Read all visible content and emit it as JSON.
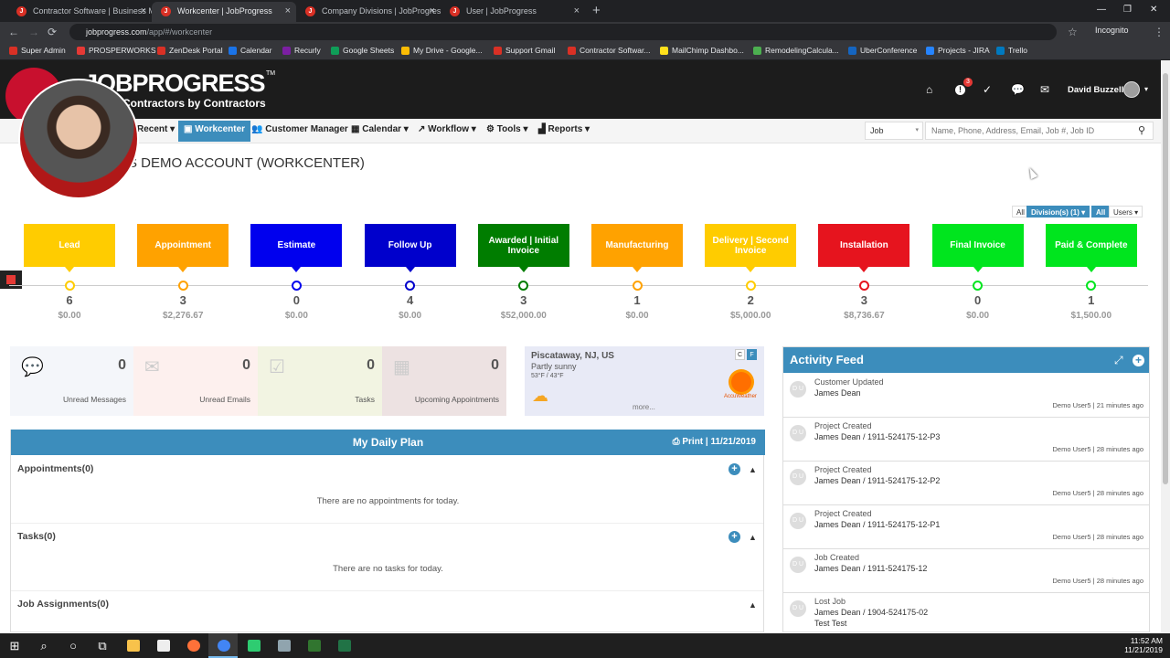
{
  "browser": {
    "tabs": [
      {
        "title": "Contractor Software | Business M",
        "active": false
      },
      {
        "title": "Workcenter | JobProgress",
        "active": true
      },
      {
        "title": "Company Divisions | JobProgress",
        "active": false
      },
      {
        "title": "User | JobProgress",
        "active": false
      }
    ],
    "new_tab": "+",
    "controls": {
      "minimize": "—",
      "maximize": "❐",
      "close": "✕"
    },
    "nav": {
      "back": "←",
      "forward": "→",
      "reload": "⟳"
    },
    "url_host": "jobprogress.com",
    "url_path": "/app/#/workcenter",
    "star": "☆",
    "incognito": "Incognito",
    "menu": "⋮",
    "bookmarks": [
      {
        "label": "Super Admin",
        "color": "#d93025"
      },
      {
        "label": "PROSPERWORKS",
        "color": "#e53935"
      },
      {
        "label": "ZenDesk Portal",
        "color": "#d93025"
      },
      {
        "label": "Calendar",
        "color": "#1a73e8"
      },
      {
        "label": "Recurly",
        "color": "#7b1fa2"
      },
      {
        "label": "Google Sheets",
        "color": "#0f9d58"
      },
      {
        "label": "My Drive - Google...",
        "color": "#fbbc04"
      },
      {
        "label": "Support Gmail",
        "color": "#d93025"
      },
      {
        "label": "Contractor Softwar...",
        "color": "#d93025"
      },
      {
        "label": "MailChimp Dashbo...",
        "color": "#ffe01b"
      },
      {
        "label": "RemodelingCalcula...",
        "color": "#4caf50"
      },
      {
        "label": "UberConference",
        "color": "#1565c0"
      },
      {
        "label": "Projects - JIRA",
        "color": "#2684ff"
      },
      {
        "label": "Trello",
        "color": "#0079bf"
      }
    ]
  },
  "app": {
    "logo": "JOBPROGRESS",
    "tm": "TM",
    "tagline": "Contractors by Contractors",
    "notification_count": "3",
    "user_name": "David Buzzelli",
    "user_caret": "▾",
    "header_icons": {
      "home": "⌂",
      "alert": "!",
      "tasks": "✓",
      "chat": "💬",
      "mail": "✉"
    },
    "nav": {
      "recent": "Recent ▾",
      "workcenter": "Workcenter",
      "customer_manager": "Customer Manager",
      "calendar": "Calendar ▾",
      "workflow": "Workflow ▾",
      "tools": "Tools ▾",
      "reports": "Reports ▾"
    },
    "search": {
      "type_value": "Job",
      "type_caret": "▾",
      "placeholder": "Name, Phone, Address, Email, Job #, Job ID",
      "icon": "⚲"
    },
    "page_title": "S DEMO ACCOUNT (WORKCENTER)",
    "filters": {
      "all1": "All",
      "divisions": "Division(s) (1) ▾",
      "all2": "All",
      "users": "Users ▾"
    }
  },
  "stages": [
    {
      "name": "Lead",
      "color": "#ffcc00",
      "count": "6",
      "amount": "$0.00"
    },
    {
      "name": "Appointment",
      "color": "#ffa200",
      "count": "3",
      "amount": "$2,276.67"
    },
    {
      "name": "Estimate",
      "color": "#0000ee",
      "count": "0",
      "amount": "$0.00"
    },
    {
      "name": "Follow Up",
      "color": "#0000cc",
      "count": "4",
      "amount": "$0.00"
    },
    {
      "name": "Awarded | Initial Invoice",
      "color": "#007d00",
      "count": "3",
      "amount": "$52,000.00"
    },
    {
      "name": "Manufacturing",
      "color": "#ffa200",
      "count": "1",
      "amount": "$0.00"
    },
    {
      "name": "Delivery | Second Invoice",
      "color": "#ffcc00",
      "count": "2",
      "amount": "$5,000.00"
    },
    {
      "name": "Installation",
      "color": "#e6141e",
      "count": "3",
      "amount": "$8,736.67"
    },
    {
      "name": "Final Invoice",
      "color": "#00e51e",
      "count": "0",
      "amount": "$0.00"
    },
    {
      "name": "Paid & Complete",
      "color": "#00e51e",
      "count": "1",
      "amount": "$1,500.00"
    }
  ],
  "stats": [
    {
      "label": "Unread Messages",
      "value": "0",
      "icon": "💬",
      "bg": "#f4f6fa"
    },
    {
      "label": "Unread Emails",
      "value": "0",
      "icon": "✉",
      "bg": "#fdf0ee"
    },
    {
      "label": "Tasks",
      "value": "0",
      "icon": "☑",
      "bg": "#f2f4e2"
    },
    {
      "label": "Upcoming Appointments",
      "value": "0",
      "icon": "▦",
      "bg": "#ede2e2"
    }
  ],
  "weather": {
    "city": "Piscataway, NJ, US",
    "desc": "Partly sunny",
    "temp": "53°F / 43°F",
    "more": "more...",
    "brand": "AccuWeather",
    "c": "C",
    "f": "F",
    "cloud": "☁"
  },
  "daily_plan": {
    "title": "My Daily Plan",
    "print": "⎙ Print | 11/21/2019",
    "appointments": "Appointments(0)",
    "no_appointments": "There are no appointments for today.",
    "tasks": "Tasks(0)",
    "no_tasks": "There are no tasks for today.",
    "job_assignments": "Job Assignments(0)",
    "plus": "+",
    "caret": "▲"
  },
  "activity_feed": {
    "title": "Activity Feed",
    "expand": "⤢",
    "add": "+",
    "items": [
      {
        "initials": "D U",
        "action": "Customer Updated",
        "detail": "James Dean",
        "extra": "",
        "meta": "Demo User5 | 21 minutes ago"
      },
      {
        "initials": "D U",
        "action": "Project Created",
        "detail": "James Dean / 1911-524175-12-P3",
        "extra": "",
        "meta": "Demo User5 | 28 minutes ago"
      },
      {
        "initials": "D U",
        "action": "Project Created",
        "detail": "James Dean / 1911-524175-12-P2",
        "extra": "",
        "meta": "Demo User5 | 28 minutes ago"
      },
      {
        "initials": "D U",
        "action": "Project Created",
        "detail": "James Dean / 1911-524175-12-P1",
        "extra": "",
        "meta": "Demo User5 | 28 minutes ago"
      },
      {
        "initials": "D U",
        "action": "Job Created",
        "detail": "James Dean / 1911-524175-12",
        "extra": "",
        "meta": "Demo User5 | 28 minutes ago"
      },
      {
        "initials": "D U",
        "action": "Lost Job",
        "detail": "James Dean / 1904-524175-02",
        "extra": "Test Test",
        "meta": ""
      }
    ]
  },
  "taskbar": {
    "start": "⊞",
    "search": "⌕",
    "cortana": "○",
    "taskview": "⧉",
    "time": "11:52 AM",
    "date": "11/21/2019",
    "apps": [
      {
        "name": "file-explorer",
        "color": "#f8c24b"
      },
      {
        "name": "amazon",
        "color": "#eeeeee"
      },
      {
        "name": "firefox",
        "color": "#ff7139"
      },
      {
        "name": "chrome",
        "color": "#4285f4"
      },
      {
        "name": "chat-app",
        "color": "#2ecc71"
      },
      {
        "name": "network-app",
        "color": "#90a4ae"
      },
      {
        "name": "project-app",
        "color": "#31752f"
      },
      {
        "name": "excel",
        "color": "#217346"
      }
    ]
  }
}
